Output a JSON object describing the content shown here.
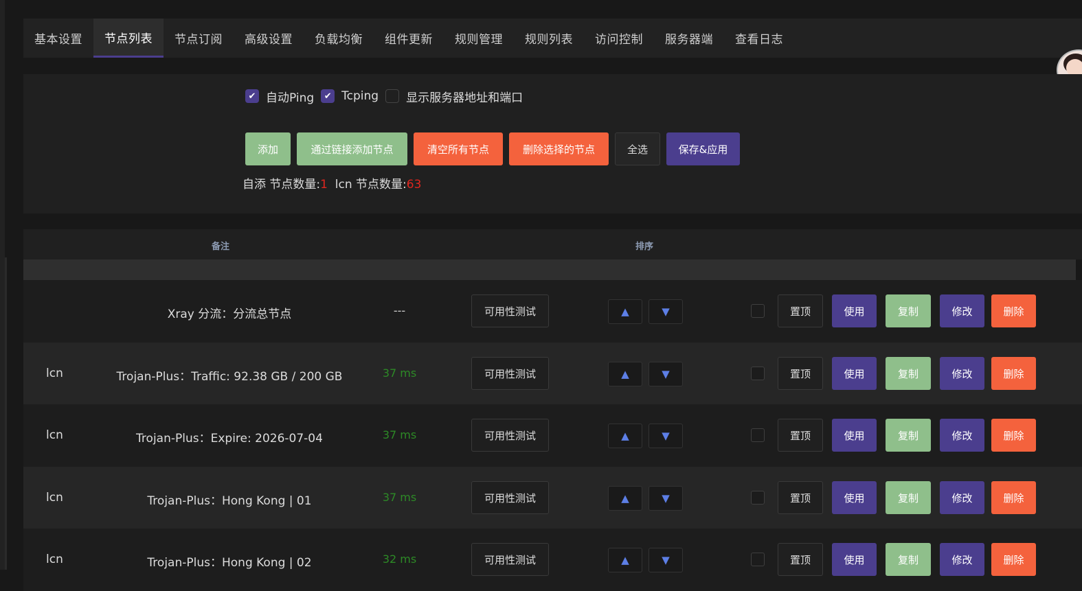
{
  "tabs": [
    "基本设置",
    "节点列表",
    "节点订阅",
    "高级设置",
    "负载均衡",
    "组件更新",
    "规则管理",
    "规则列表",
    "访问控制",
    "服务器端",
    "查看日志"
  ],
  "active_tab": "节点列表",
  "options": {
    "auto_ping": {
      "label": "自动Ping",
      "checked": true
    },
    "tcping": {
      "label": "Tcping",
      "checked": true
    },
    "show_server": {
      "label": "显示服务器地址和端口",
      "checked": false
    }
  },
  "buttons": {
    "add": "添加",
    "add_by_link": "通过链接添加节点",
    "clear_all": "清空所有节点",
    "delete_selected": "删除选择的节点",
    "select_all": "全选",
    "save_apply": "保存&应用"
  },
  "counts": {
    "self_label": "自添 节点数量:",
    "self_value": "1",
    "lcn_label": "lcn 节点数量:",
    "lcn_value": "63"
  },
  "table": {
    "col_remark": "备注",
    "col_sort": "排序",
    "labels": {
      "test": "可用性测试",
      "up": "▲",
      "down": "▼",
      "top": "置顶",
      "use": "使用",
      "copy": "复制",
      "edit": "修改",
      "delete": "删除"
    },
    "rows": [
      {
        "type": "",
        "name": "Xray 分流：分流总节点",
        "ping": "---"
      },
      {
        "type": "lcn",
        "name": "Trojan-Plus：Traffic: 92.38 GB / 200 GB",
        "ping": "37 ms"
      },
      {
        "type": "lcn",
        "name": "Trojan-Plus：Expire: 2026-07-04",
        "ping": "37 ms"
      },
      {
        "type": "lcn",
        "name": "Trojan-Plus：Hong Kong | 01",
        "ping": "37 ms"
      },
      {
        "type": "lcn",
        "name": "Trojan-Plus：Hong Kong | 02",
        "ping": "32 ms"
      }
    ]
  },
  "colors": {
    "accent": "#4b3e8e",
    "green": "#8fbf8b",
    "red": "#f4623d",
    "ping_ok": "#2d8a26",
    "count_red": "#e0261f"
  }
}
